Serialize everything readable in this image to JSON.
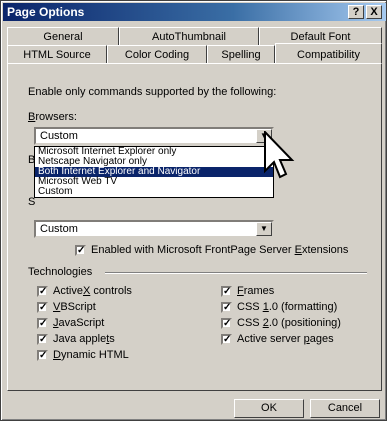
{
  "window": {
    "title": "Page Options"
  },
  "titlebar_buttons": {
    "help": "?",
    "close": "X"
  },
  "tabs": {
    "back": [
      "General",
      "AutoThumbnail",
      "Default Font"
    ],
    "front": [
      "HTML Source",
      "Color Coding",
      "Spelling",
      "Compatibility"
    ],
    "active": "Compatibility"
  },
  "compat": {
    "intro": "Enable only commands supported by the following:",
    "browsers_label_prefix": "",
    "browsers_label_ul": "B",
    "browsers_label_rest": "rowsers:",
    "browsers_value": "Custom",
    "browser_versions_label_partial": "Br",
    "servers_label_partial": "S",
    "servers_value": "Custom",
    "browser_options": [
      "Microsoft Internet Explorer only",
      "Netscape Navigator only",
      "Both Internet Explorer and Navigator",
      "Microsoft Web TV",
      "Custom"
    ],
    "selected_option": "Both Internet Explorer and Navigator",
    "frontpage_ext_prefix": "Enabled with Microsoft FrontPage Server ",
    "frontpage_ext_ul": "E",
    "frontpage_ext_rest": "xtensions",
    "technologies_label": "Technologies",
    "technologies": {
      "left": [
        {
          "pre": "Active",
          "ul": "X",
          "post": " controls"
        },
        {
          "pre": "",
          "ul": "V",
          "post": "BScript"
        },
        {
          "pre": "",
          "ul": "J",
          "post": "avaScript"
        },
        {
          "pre": "Java apple",
          "ul": "t",
          "post": "s"
        },
        {
          "pre": "",
          "ul": "D",
          "post": "ynamic HTML"
        }
      ],
      "right": [
        {
          "pre": "",
          "ul": "F",
          "post": "rames"
        },
        {
          "pre": "CSS ",
          "ul": "1",
          "post": ".0  (formatting)"
        },
        {
          "pre": "CSS ",
          "ul": "2",
          "post": ".0  (positioning)"
        },
        {
          "pre": "Active server ",
          "ul": "p",
          "post": "ages"
        }
      ]
    }
  },
  "buttons": {
    "ok": "OK",
    "cancel": "Cancel"
  }
}
